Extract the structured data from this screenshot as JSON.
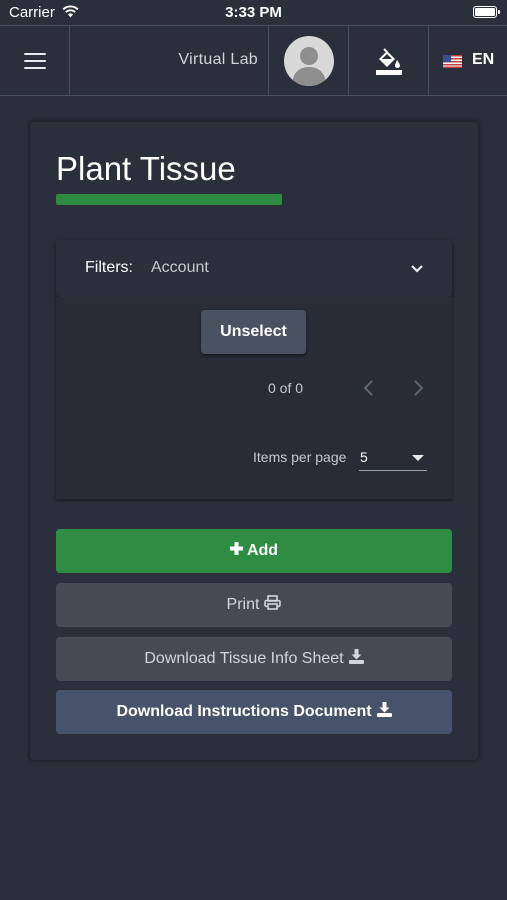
{
  "status_bar": {
    "carrier": "Carrier",
    "time": "3:33 PM"
  },
  "header": {
    "app_title": "Virtual Lab",
    "language": "EN",
    "icons": {
      "menu": "hamburger-menu-icon",
      "avatar": "user-avatar",
      "theme": "paint-bucket-icon",
      "flag": "us-flag-icon"
    }
  },
  "page": {
    "title": "Plant Tissue",
    "accent_color": "#2f8c43"
  },
  "filters": {
    "label": "Filters:",
    "value": "Account"
  },
  "table": {
    "unselect_label": "Unselect",
    "range_label": "0 of 0",
    "items_per_page_label": "Items per page",
    "items_per_page_value": "5"
  },
  "actions": {
    "add_label": "Add",
    "print_label": "Print",
    "download_tissue_label": "Download Tissue Info Sheet",
    "download_instructions_label": "Download Instructions Document"
  },
  "colors": {
    "background": "#2b2f3b",
    "primary_green": "#2f8c43",
    "secondary_button": "#464a55",
    "instructions_button": "#46536a"
  }
}
